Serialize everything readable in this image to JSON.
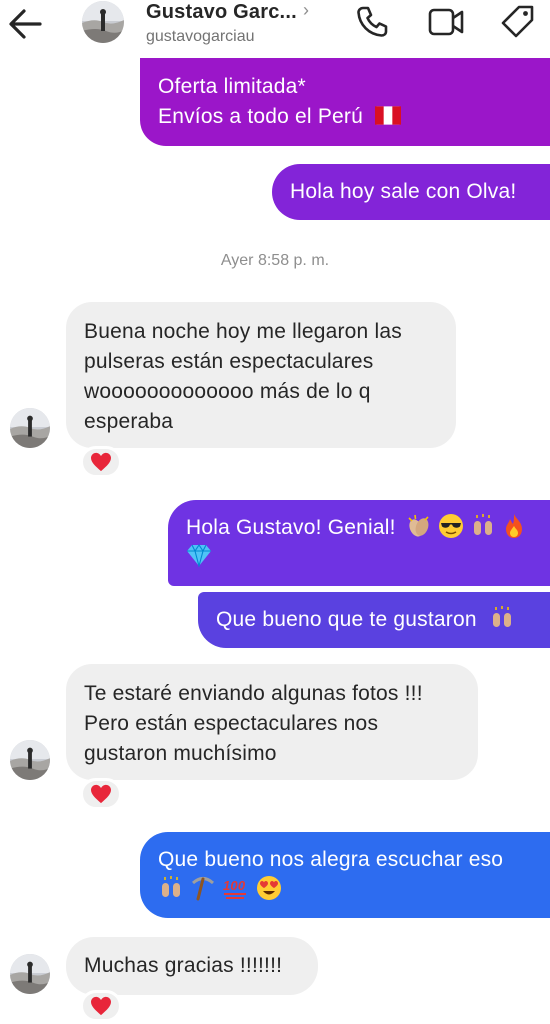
{
  "header": {
    "name": "Gustavo Garc...",
    "chevron": "›",
    "username": "gustavogarciau",
    "icons": [
      "back-arrow-icon",
      "phone-icon",
      "video-icon",
      "tag-icon"
    ]
  },
  "messages": {
    "m1": {
      "line1": "Oferta limitada*",
      "line2": "Envíos a todo el Perú"
    },
    "m2": {
      "line1": "Hola hoy sale con Olva!"
    },
    "timestamp": "Ayer 8:58 p. m.",
    "m3": {
      "line1": "Buena noche hoy me llegaron las",
      "line2": "pulseras están espectaculares",
      "line3": "wooooooooooooo más de lo q",
      "line4": "esperaba"
    },
    "m4": {
      "line1": "Hola Gustavo! Genial!"
    },
    "m5": {
      "line1": "Que bueno que te gustaron"
    },
    "m6": {
      "line1": "Te estaré enviando algunas fotos !!!",
      "line2": "Pero están espectaculares nos",
      "line3": "gustaron muchísimo"
    },
    "m7": {
      "line1": "Que bueno nos alegra escuchar eso"
    },
    "m8": {
      "line1": "Muchas gracias !!!!!!!"
    }
  },
  "colors": {
    "purple": "#9b16c9",
    "violet": "#7a2ee6",
    "indigo": "#5a41e0",
    "blue": "#2d6cf0",
    "incoming": "#efefef",
    "heart": "#e8263a"
  }
}
